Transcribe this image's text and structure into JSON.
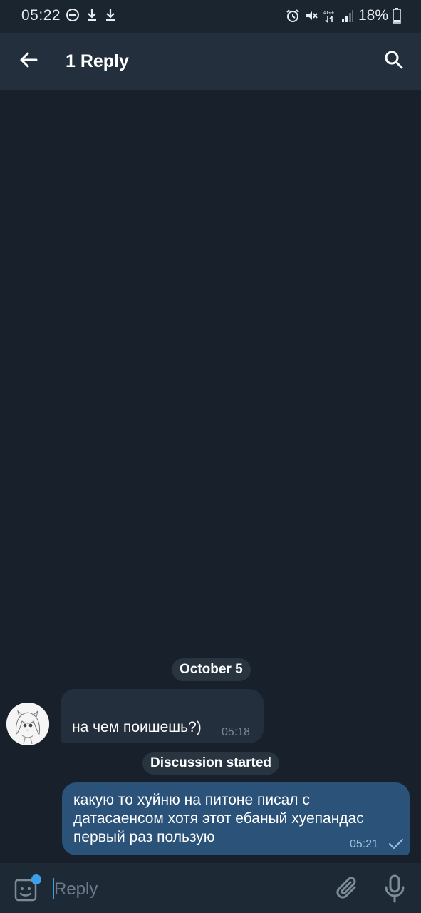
{
  "status_bar": {
    "time": "05:22",
    "battery": "18%",
    "network": "4G+",
    "icons_left": [
      "do-not-disturb-icon",
      "download-icon",
      "download-icon"
    ],
    "icons_right": [
      "alarm-icon",
      "mute-icon",
      "network-4g-icon",
      "signal-icon",
      "battery-icon"
    ]
  },
  "header": {
    "title": "1 Reply",
    "back_icon": "arrow-left-icon",
    "search_icon": "search-icon"
  },
  "chat": {
    "date_separator": "October 5",
    "messages": [
      {
        "direction": "incoming",
        "text": "на чем поишешь?)",
        "time": "05:18"
      },
      {
        "direction": "outgoing",
        "text": "какую то хуйню на питоне писал с датасаенсом хотя этот ебаный хуепандас первый раз пользую",
        "time": "05:21",
        "status": "sent"
      }
    ],
    "system_message": "Discussion started"
  },
  "input_bar": {
    "placeholder": "Reply",
    "value": ""
  },
  "colors": {
    "background": "#17202b",
    "header": "#232f3d",
    "incoming_bubble": "#242f3d",
    "outgoing_bubble": "#2b5278",
    "accent": "#3e9eea"
  }
}
